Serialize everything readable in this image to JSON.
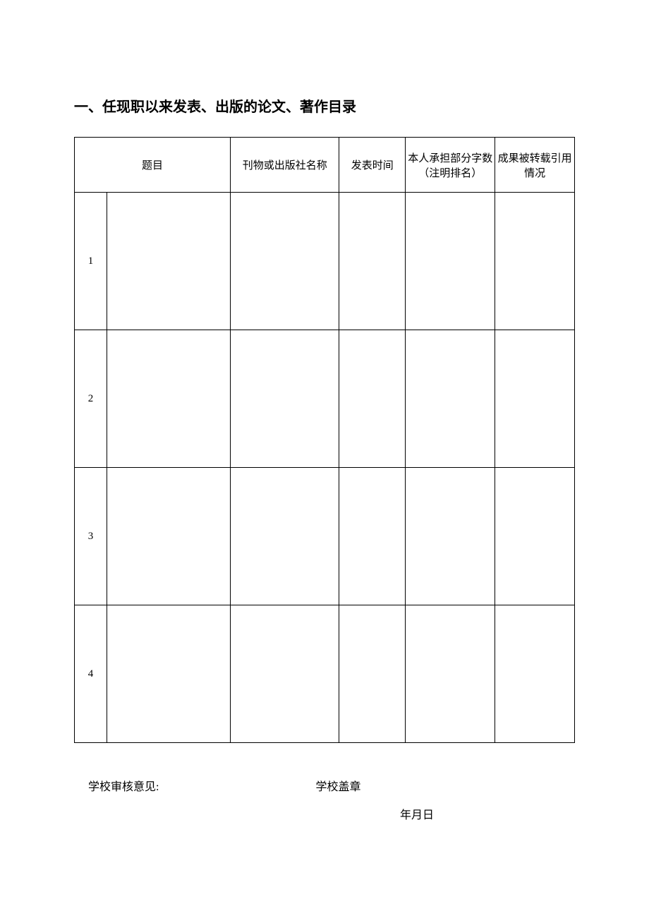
{
  "section_title": "一、任现职以来发表、出版的论文、著作目录",
  "table": {
    "headers": {
      "topic": "题目",
      "publication": "刊物或出版社名称",
      "date": "发表时间",
      "words": "本人承担部分字数（注明排名）",
      "citation": "成果被转载引用情况"
    },
    "rows": [
      {
        "num": "1",
        "topic": "",
        "publication": "",
        "date": "",
        "words": "",
        "citation": ""
      },
      {
        "num": "2",
        "topic": "",
        "publication": "",
        "date": "",
        "words": "",
        "citation": ""
      },
      {
        "num": "3",
        "topic": "",
        "publication": "",
        "date": "",
        "words": "",
        "citation": ""
      },
      {
        "num": "4",
        "topic": "",
        "publication": "",
        "date": "",
        "words": "",
        "citation": ""
      }
    ]
  },
  "footer": {
    "review_label": "学校审核意见:",
    "stamp_label": "学校盖章",
    "date_label": "年月日"
  }
}
